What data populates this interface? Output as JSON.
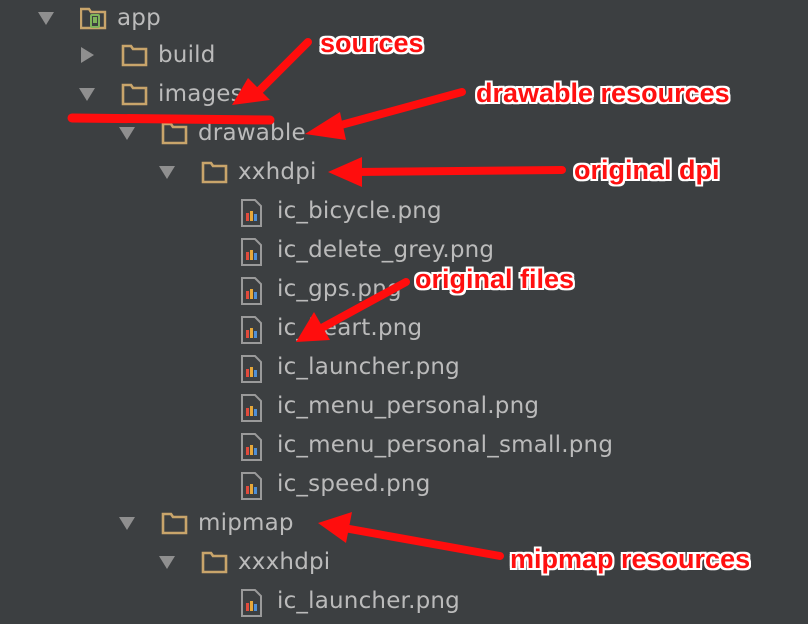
{
  "tree": {
    "app": "app",
    "build": "build",
    "images": "images",
    "drawable": "drawable",
    "xxhdpi": "xxhdpi",
    "files_xxhdpi": [
      "ic_bicycle.png",
      "ic_delete_grey.png",
      "ic_gps.png",
      "ic_heart.png",
      "ic_launcher.png",
      "ic_menu_personal.png",
      "ic_menu_personal_small.png",
      "ic_speed.png"
    ],
    "mipmap": "mipmap",
    "xxxhdpi": "xxxhdpi",
    "files_xxxhdpi": [
      "ic_launcher.png"
    ]
  },
  "annotations": {
    "sources": "sources",
    "drawable_resources": "drawable resources",
    "original_dpi": "original dpi",
    "original_files": "original files",
    "mipmap_resources": "mipmap resources"
  },
  "colors": {
    "background": "#3c3f41",
    "text": "#bbbbbb",
    "folder": "#c9a56b",
    "annotation": "#ff1010"
  },
  "icons": {
    "module": "module-folder-icon",
    "folder": "folder-icon",
    "file": "png-file-icon",
    "expanded": "triangle-down-icon",
    "collapsed": "triangle-right-icon"
  }
}
